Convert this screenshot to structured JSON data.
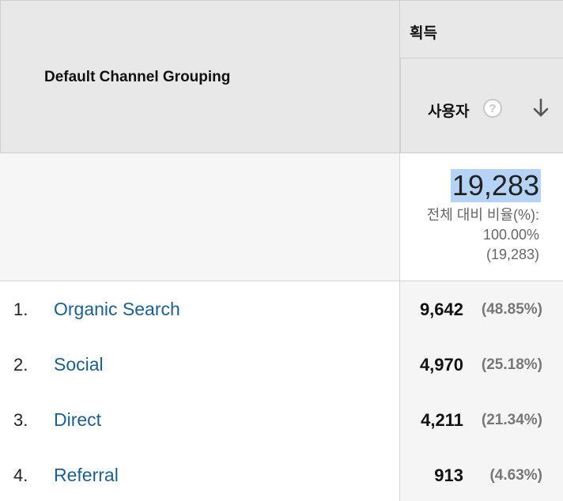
{
  "header": {
    "dimension_label": "Default Channel Grouping",
    "group_label": "획득",
    "metric_label": "사용자",
    "help_glyph": "?"
  },
  "totals": {
    "value": "19,283",
    "percent_label": "전체 대비 비율(%):",
    "percent_value": "100.00%",
    "total_in_parens": "(19,283)"
  },
  "rows": [
    {
      "index": "1.",
      "channel": "Organic Search",
      "users": "9,642",
      "percent": "(48.85%)"
    },
    {
      "index": "2.",
      "channel": "Social",
      "users": "4,970",
      "percent": "(25.18%)"
    },
    {
      "index": "3.",
      "channel": "Direct",
      "users": "4,211",
      "percent": "(21.34%)"
    },
    {
      "index": "4.",
      "channel": "Referral",
      "users": "913",
      "percent": "(4.63%)"
    }
  ],
  "colors": {
    "link": "#1a5f95",
    "header_bg": "#e8e8e8",
    "selection": "#b5d3f5"
  }
}
